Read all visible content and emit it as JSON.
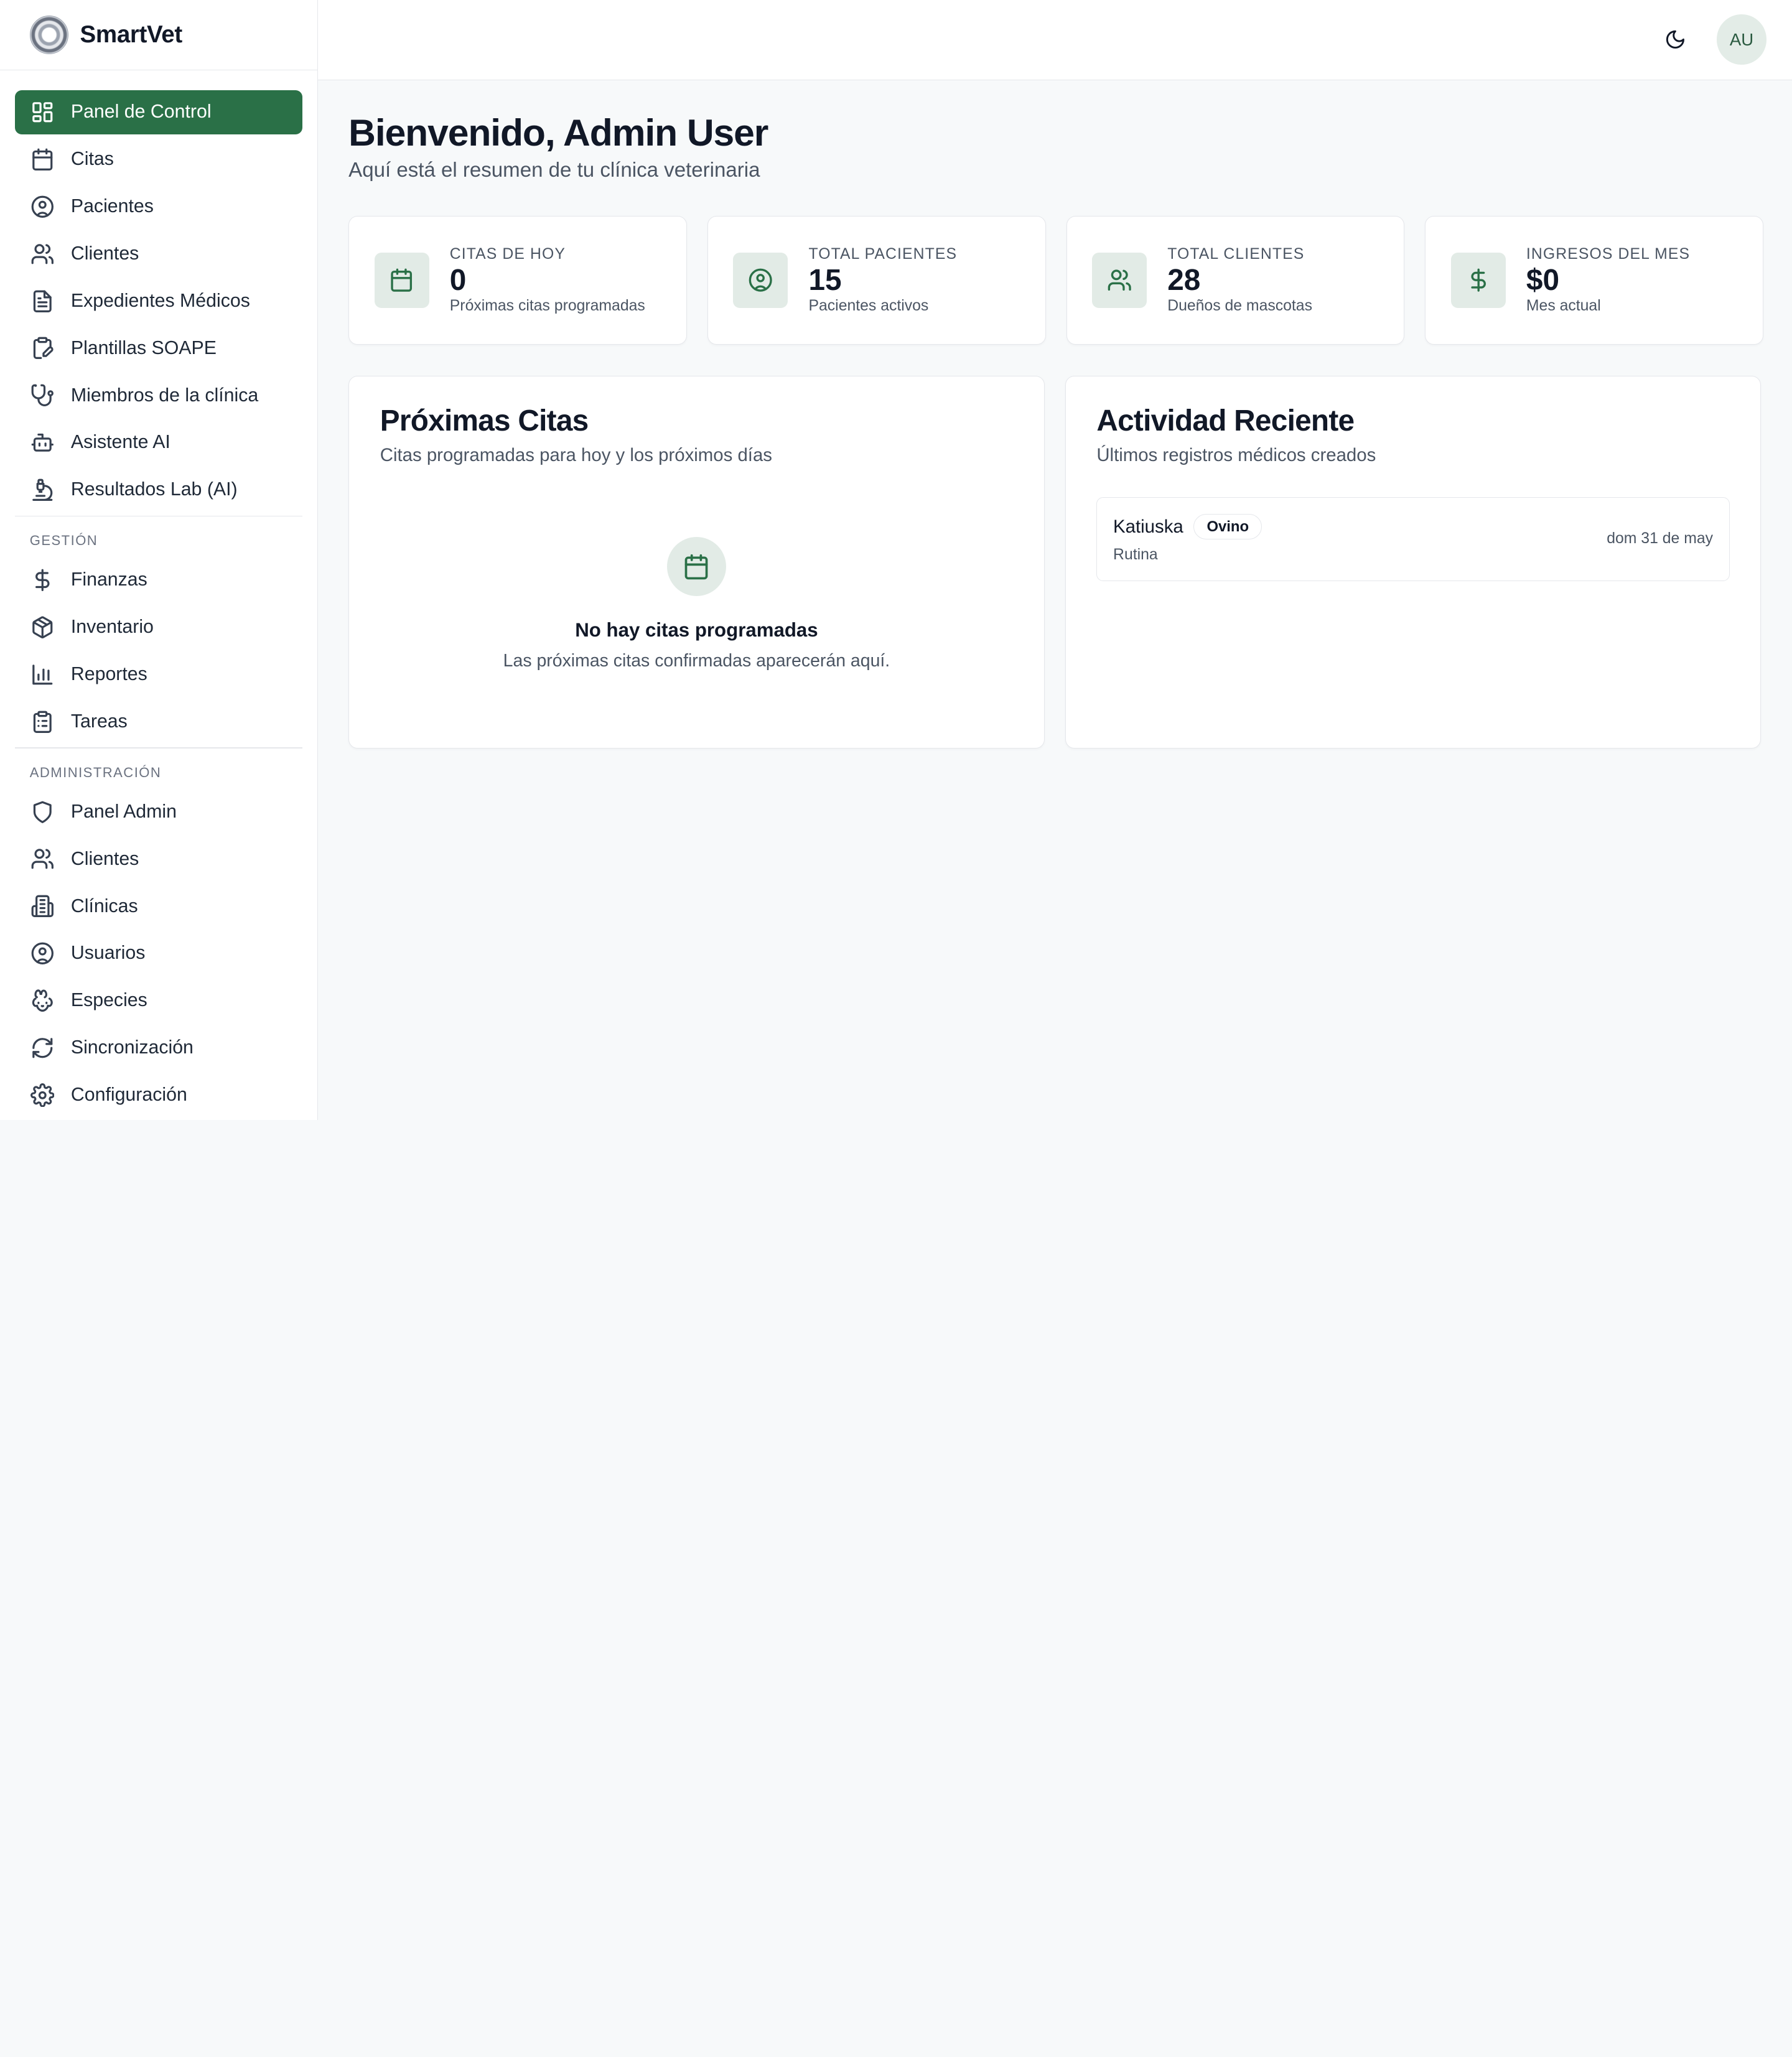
{
  "brand": {
    "name": "SmartVet"
  },
  "colors": {
    "accent": "#2a7047",
    "accent_soft": "#e2ebe6",
    "background": "#f7f9fa"
  },
  "sidebar": {
    "items": [
      {
        "label": "Panel de Control",
        "icon": "layout-dashboard-icon",
        "active": true
      },
      {
        "label": "Citas",
        "icon": "calendar-icon"
      },
      {
        "label": "Pacientes",
        "icon": "user-circle-icon"
      },
      {
        "label": "Clientes",
        "icon": "users-icon"
      },
      {
        "label": "Expedientes Médicos",
        "icon": "file-text-icon"
      },
      {
        "label": "Plantillas SOAPE",
        "icon": "clipboard-edit-icon"
      },
      {
        "label": "Miembros de la clínica",
        "icon": "stethoscope-icon"
      },
      {
        "label": "Asistente AI",
        "icon": "bot-icon"
      },
      {
        "label": "Resultados Lab (AI)",
        "icon": "microscope-icon"
      }
    ],
    "gestion": {
      "title": "GESTIÓN",
      "items": [
        {
          "label": "Finanzas",
          "icon": "dollar-icon"
        },
        {
          "label": "Inventario",
          "icon": "package-icon"
        },
        {
          "label": "Reportes",
          "icon": "bar-chart-icon"
        },
        {
          "label": "Tareas",
          "icon": "clipboard-list-icon"
        }
      ]
    },
    "admin": {
      "title": "ADMINISTRACIÓN",
      "items": [
        {
          "label": "Panel Admin",
          "icon": "shield-icon"
        },
        {
          "label": "Clientes",
          "icon": "users-icon"
        },
        {
          "label": "Clínicas",
          "icon": "building-icon"
        },
        {
          "label": "Usuarios",
          "icon": "user-circle-icon"
        },
        {
          "label": "Especies",
          "icon": "paw-icon"
        },
        {
          "label": "Sincronización",
          "icon": "refresh-icon"
        },
        {
          "label": "Configuración",
          "icon": "gear-icon"
        }
      ]
    }
  },
  "header": {
    "avatar_initials": "AU",
    "theme_icon": "moon-icon"
  },
  "main": {
    "title": "Bienvenido, Admin User",
    "subtitle": "Aquí está el resumen de tu clínica veterinaria",
    "stats": [
      {
        "label": "CITAS DE HOY",
        "value": "0",
        "desc": "Próximas citas programadas",
        "icon": "calendar-icon"
      },
      {
        "label": "TOTAL PACIENTES",
        "value": "15",
        "desc": "Pacientes activos",
        "icon": "user-circle-icon"
      },
      {
        "label": "TOTAL CLIENTES",
        "value": "28",
        "desc": "Dueños de mascotas",
        "icon": "users-icon"
      },
      {
        "label": "INGRESOS DEL MES",
        "value": "$0",
        "desc": "Mes actual",
        "icon": "dollar-icon"
      }
    ],
    "upcoming": {
      "title": "Próximas Citas",
      "subtitle": "Citas programadas para hoy y los próximos días",
      "empty_title": "No hay citas programadas",
      "empty_sub": "Las próximas citas confirmadas aparecerán aquí."
    },
    "activity": {
      "title": "Actividad Reciente",
      "subtitle": "Últimos registros médicos creados",
      "items": [
        {
          "name": "Katiuska",
          "species": "Ovino",
          "type": "Rutina",
          "date": "dom 31 de may"
        }
      ]
    }
  }
}
